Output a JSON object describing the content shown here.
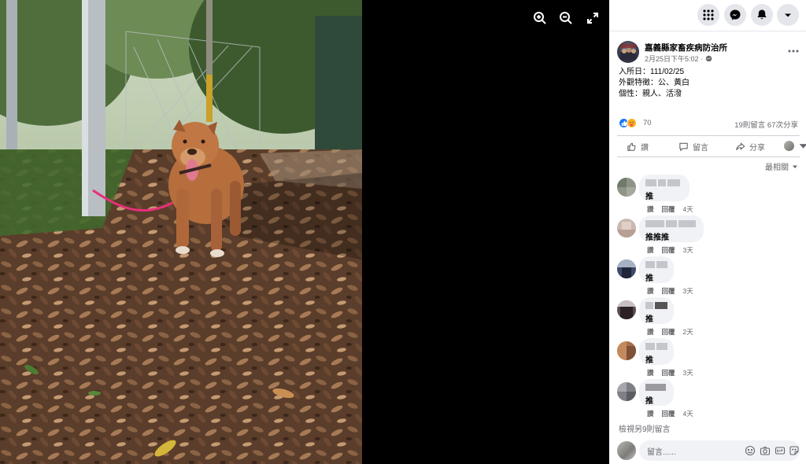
{
  "viewer": {
    "icons": [
      "zoom-in-icon",
      "zoom-out-icon",
      "fullscreen-icon"
    ]
  },
  "topbar": {
    "icons": [
      "menu-grid-icon",
      "messenger-icon",
      "notifications-bell-icon",
      "account-dropdown-icon"
    ]
  },
  "post": {
    "author": "嘉義縣家畜疾病防治所",
    "time": "2月25日下午5:02 · ",
    "body": [
      "入所日：111/02/25",
      "外觀特徵：公、黃白",
      "個性：親人、活潑"
    ],
    "reaction_count": "70",
    "stats": "19則留言  67次分享"
  },
  "actions": {
    "like": "讚",
    "comment": "留言",
    "share": "分享"
  },
  "sort_label": "最相關",
  "comments": [
    {
      "text": "推",
      "like": "讚",
      "reply": "回覆",
      "time": "4天"
    },
    {
      "text": "推推推",
      "like": "讚",
      "reply": "回覆",
      "time": "3天"
    },
    {
      "text": "推",
      "like": "讚",
      "reply": "回覆",
      "time": "3天"
    },
    {
      "text": "推",
      "like": "讚",
      "reply": "回覆",
      "time": "2天"
    },
    {
      "text": "推",
      "like": "讚",
      "reply": "回覆",
      "time": "3天"
    },
    {
      "text": "推",
      "like": "讚",
      "reply": "回覆",
      "time": "4天"
    }
  ],
  "more_comments": "檢視另9則留言",
  "composer": {
    "placeholder": "留言......"
  },
  "colors": {
    "like_blue": "#1877f2",
    "muted_text": "#65676b"
  }
}
